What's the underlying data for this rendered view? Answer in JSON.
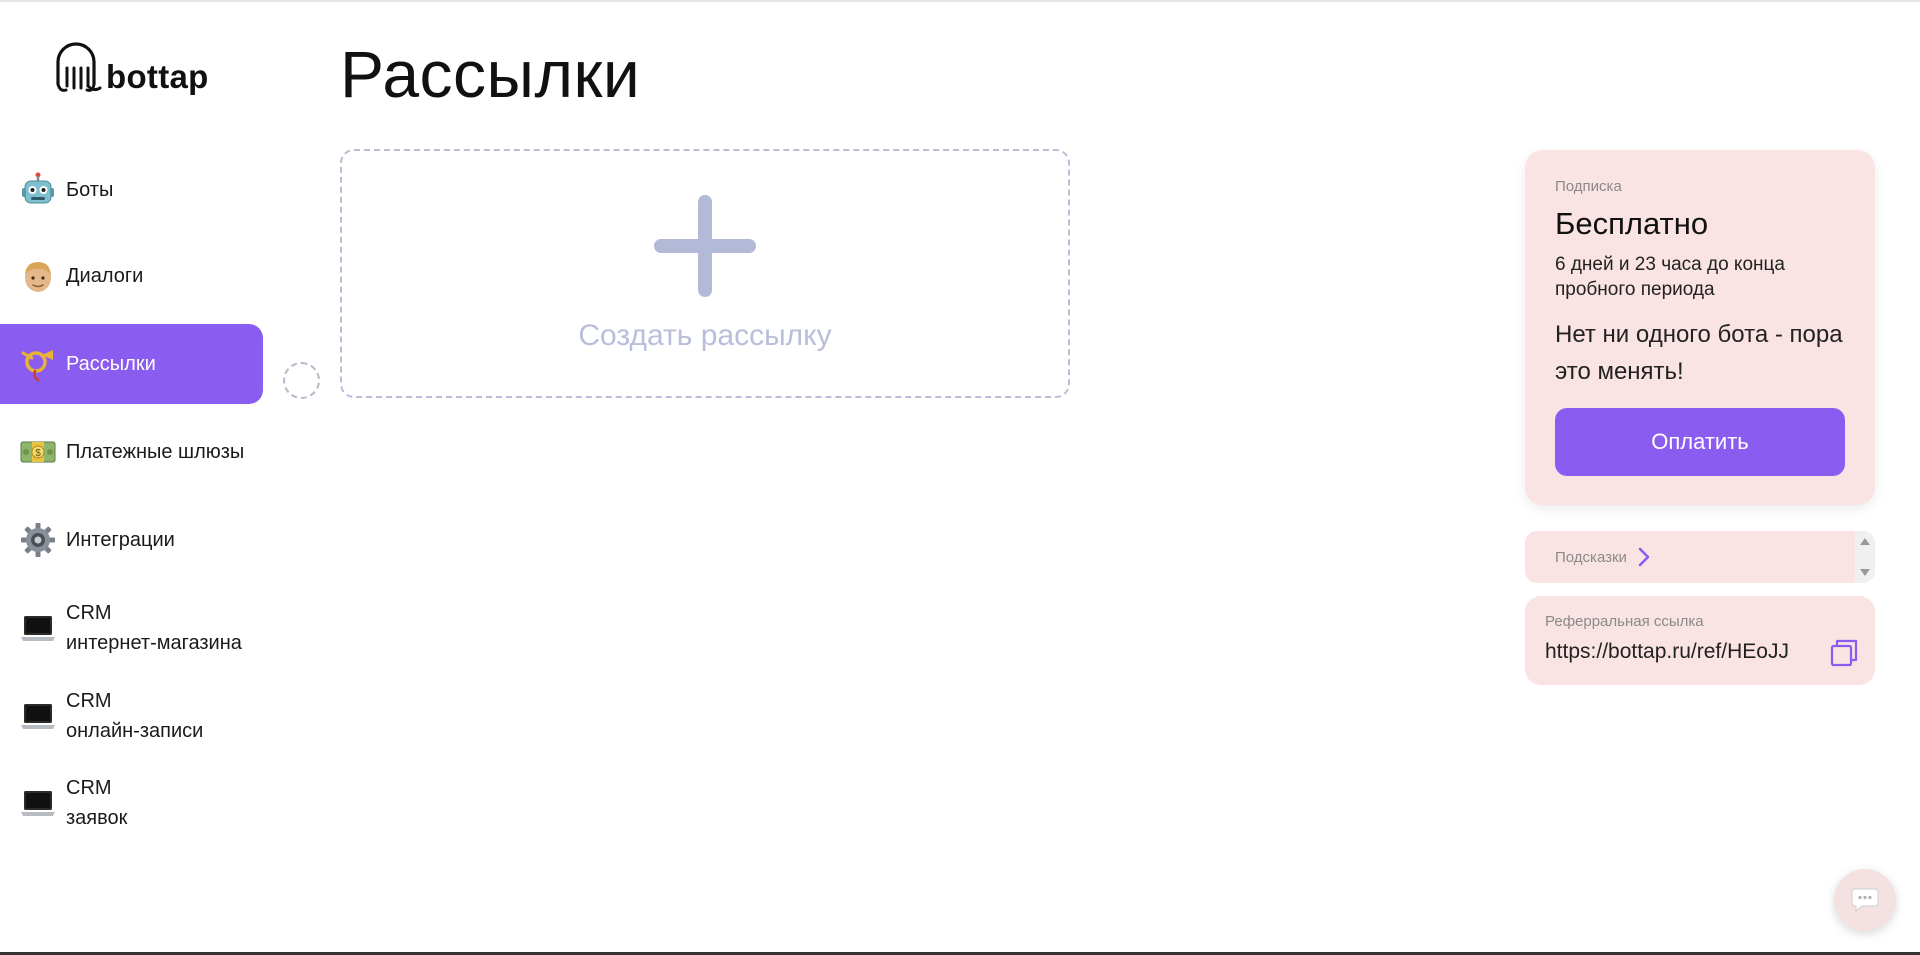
{
  "brand": {
    "name": "bottap"
  },
  "page": {
    "title": "Рассылки"
  },
  "sidebar": {
    "items": [
      {
        "label": "Боты",
        "icon": "robot-icon",
        "active": false
      },
      {
        "label": "Диалоги",
        "icon": "person-face-icon",
        "active": false
      },
      {
        "label": "Рассылки",
        "icon": "postal-horn-icon",
        "active": true
      },
      {
        "label": "Платежные шлюзы",
        "icon": "money-icon",
        "active": false
      },
      {
        "label": "Интеграции",
        "icon": "gear-icon",
        "active": false
      },
      {
        "label": "CRM",
        "label2": "интернет-магазина",
        "icon": "laptop-icon",
        "active": false
      },
      {
        "label": "CRM",
        "label2": "онлайн-записи",
        "icon": "laptop-icon",
        "active": false
      },
      {
        "label": "CRM",
        "label2": "заявок",
        "icon": "laptop-icon",
        "active": false
      }
    ]
  },
  "create": {
    "label": "Создать рассылку",
    "icon": "plus-icon"
  },
  "subscription": {
    "label": "Подписка",
    "plan": "Бесплатно",
    "trial": "6 дней и 23 часа до конца пробного периода",
    "message": "Нет ни одного бота - пора это менять!",
    "pay_label": "Оплатить"
  },
  "hints": {
    "label": "Подсказки",
    "icon": "chevron-right-icon"
  },
  "referral": {
    "label": "Реферральная ссылка",
    "link": "https://bottap.ru/ref/HEoJJ",
    "icon": "copy-icon"
  },
  "chat": {
    "icon": "chat-bubble-icon"
  },
  "colors": {
    "accent": "#8b5cf0",
    "card_bg": "#f9e3e3",
    "plus": "#b3bad8"
  }
}
